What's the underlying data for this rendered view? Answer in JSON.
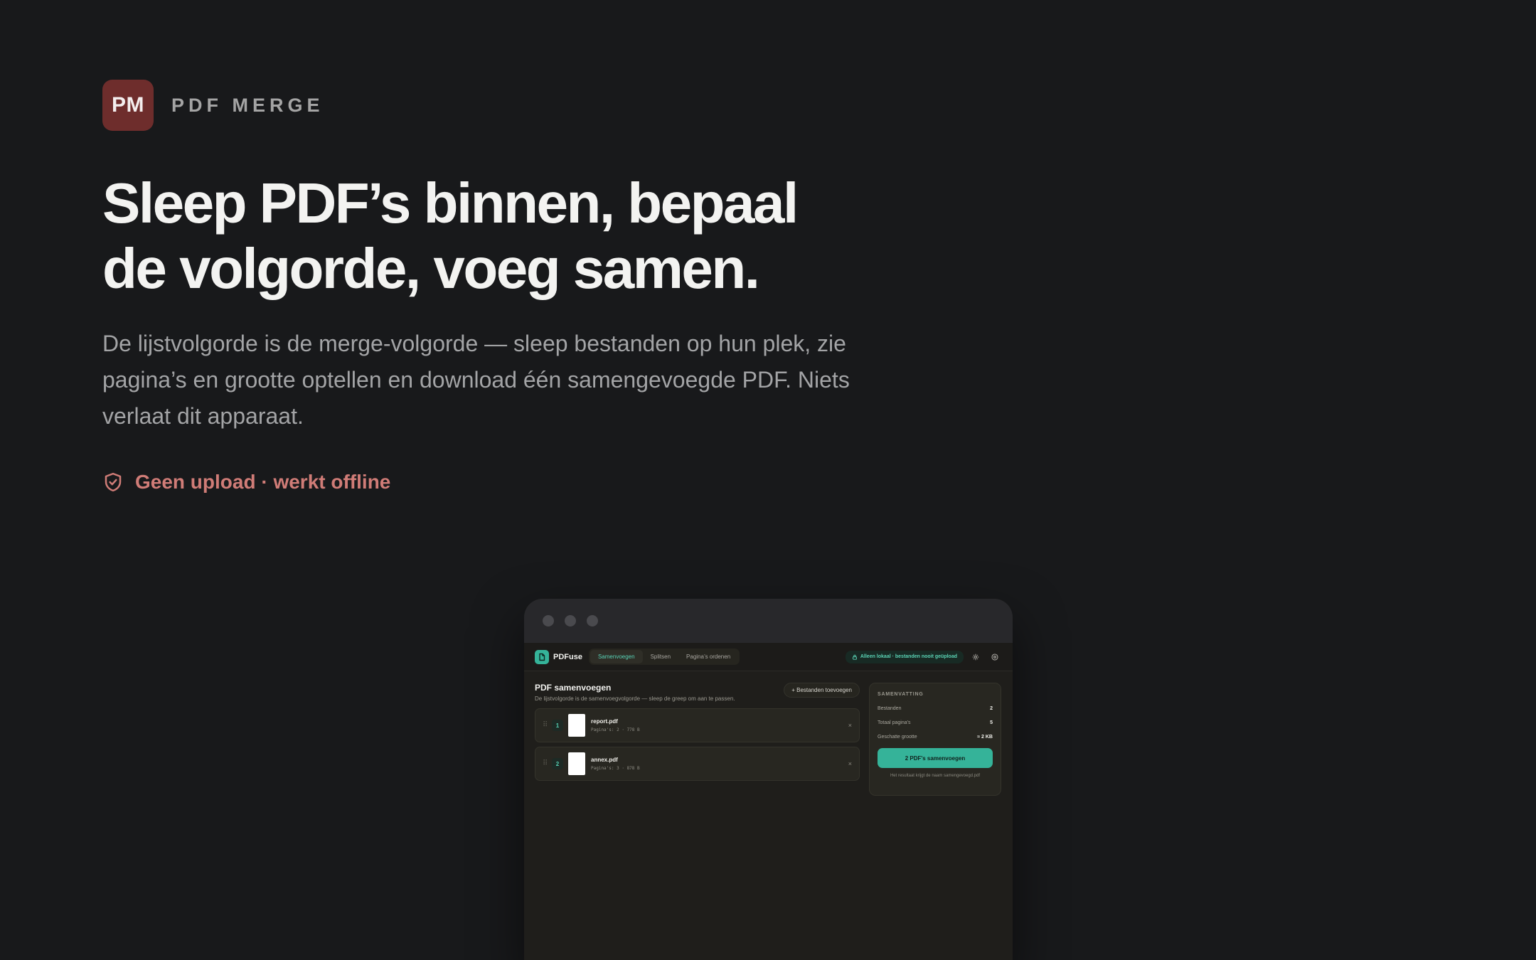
{
  "brand": {
    "logo_text": "PM",
    "name": "PDF MERGE"
  },
  "hero": {
    "headline_line1": "Sleep PDF’s binnen, bepaal",
    "headline_line2": "de volgorde, voeg samen.",
    "lead": "De lijstvolgorde is de merge-volgorde — sleep bestanden op hun plek, zie pagina’s en grootte optellen en download één samengevoegde PDF. Niets verlaat dit apparaat.",
    "trust": "Geen upload · werkt offline"
  },
  "app": {
    "name": "PDFuse",
    "tabs": [
      {
        "label": "Samenvoegen"
      },
      {
        "label": "Splitsen"
      },
      {
        "label": "Pagina’s ordenen"
      }
    ],
    "local_badge": "Alleen lokaal · bestanden nooit geüpload",
    "main": {
      "title": "PDF samenvoegen",
      "subtitle": "De lijstvolgorde is de samenvoegvolgorde — sleep de greep om aan te passen.",
      "add_button": "+ Bestanden toevoegen"
    },
    "files": [
      {
        "num": "1",
        "name": "report.pdf",
        "meta": "Pagina's: 2 · 778 B",
        "remove": "×"
      },
      {
        "num": "2",
        "name": "annex.pdf",
        "meta": "Pagina's: 3 · 878 B",
        "remove": "×"
      }
    ],
    "summary": {
      "title": "SAMENVATTING",
      "files_label": "Bestanden",
      "files_value": "2",
      "pages_label": "Totaal pagina's",
      "pages_value": "5",
      "size_label": "Geschatte grootte",
      "size_value": "≈ 2 KB",
      "merge_button": "2 PDF's samenvoegen",
      "footnote": "Het resultaat krijgt de naam samengevoegd.pdf"
    }
  },
  "colors": {
    "background": "#18191b",
    "brand": "#6e2d2c",
    "trust": "#d07c77",
    "accent": "#35b399"
  },
  "icons": {
    "trust": "shield-check-icon",
    "app_logo": "document-icon",
    "lock": "lock-icon",
    "settings": "gear-icon",
    "help": "help-circle-icon"
  }
}
